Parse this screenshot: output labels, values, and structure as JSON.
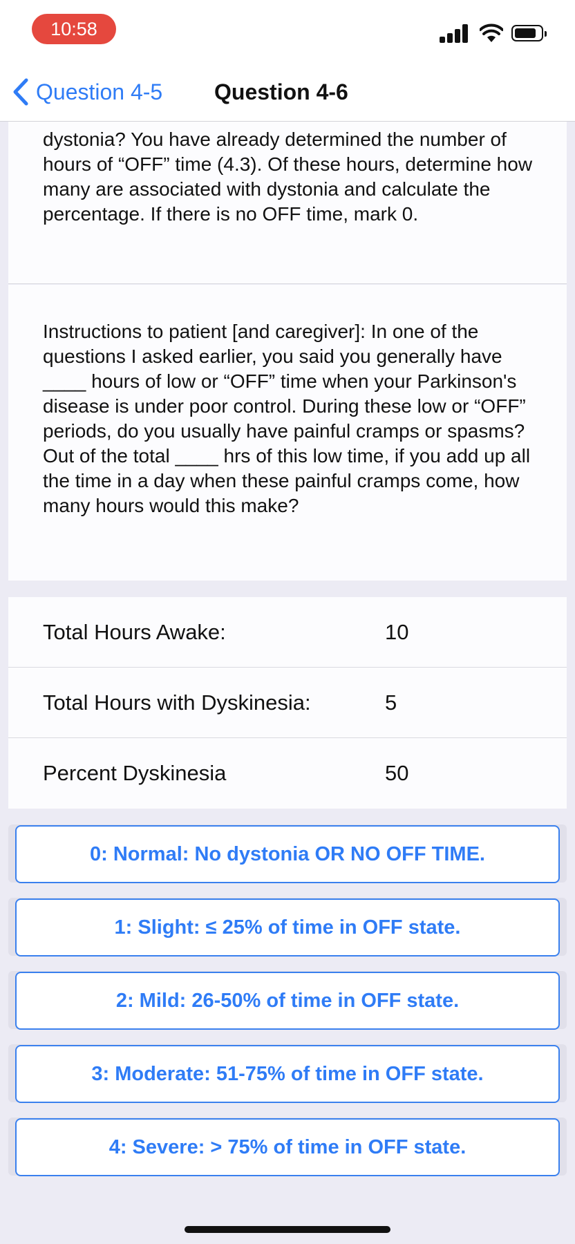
{
  "status_bar": {
    "time": "10:58",
    "icons": [
      "signal-icon",
      "wifi-icon",
      "battery-icon"
    ]
  },
  "nav": {
    "back_label": "Question 4-5",
    "title": "Question 4-6"
  },
  "question": {
    "description": "dystonia? You have already determined the number of hours of “OFF” time (4.3). Of these hours, determine how many are associated with dystonia and calculate the percentage. If there is no OFF time, mark 0.",
    "instructions": "Instructions to patient [and caregiver]: In one of the questions I asked earlier, you said you generally have ____ hours of low or “OFF” time when your Parkinson's disease is under poor control. During these low or “OFF” periods, do you usually have painful cramps or spasms? Out of the total ____ hrs of this low time, if you add up all the time in a day when these painful cramps come, how many hours would this make?"
  },
  "summary": [
    {
      "label": "Total Hours Awake:",
      "value": "10"
    },
    {
      "label": "Total Hours with Dyskinesia:",
      "value": "5"
    },
    {
      "label": "Percent Dyskinesia",
      "value": "50"
    }
  ],
  "options": [
    {
      "label": "0: Normal: No dystonia OR NO OFF TIME."
    },
    {
      "label": "1: Slight: ≤ 25% of time in OFF state."
    },
    {
      "label": "2: Mild: 26-50% of time in OFF state."
    },
    {
      "label": "3: Moderate: 51-75% of time in OFF state."
    },
    {
      "label": "4: Severe: > 75% of time in OFF state."
    }
  ],
  "colors": {
    "accent": "#2F7CF6",
    "time_pill": "#E5483E",
    "background": "#ECEBF4"
  }
}
